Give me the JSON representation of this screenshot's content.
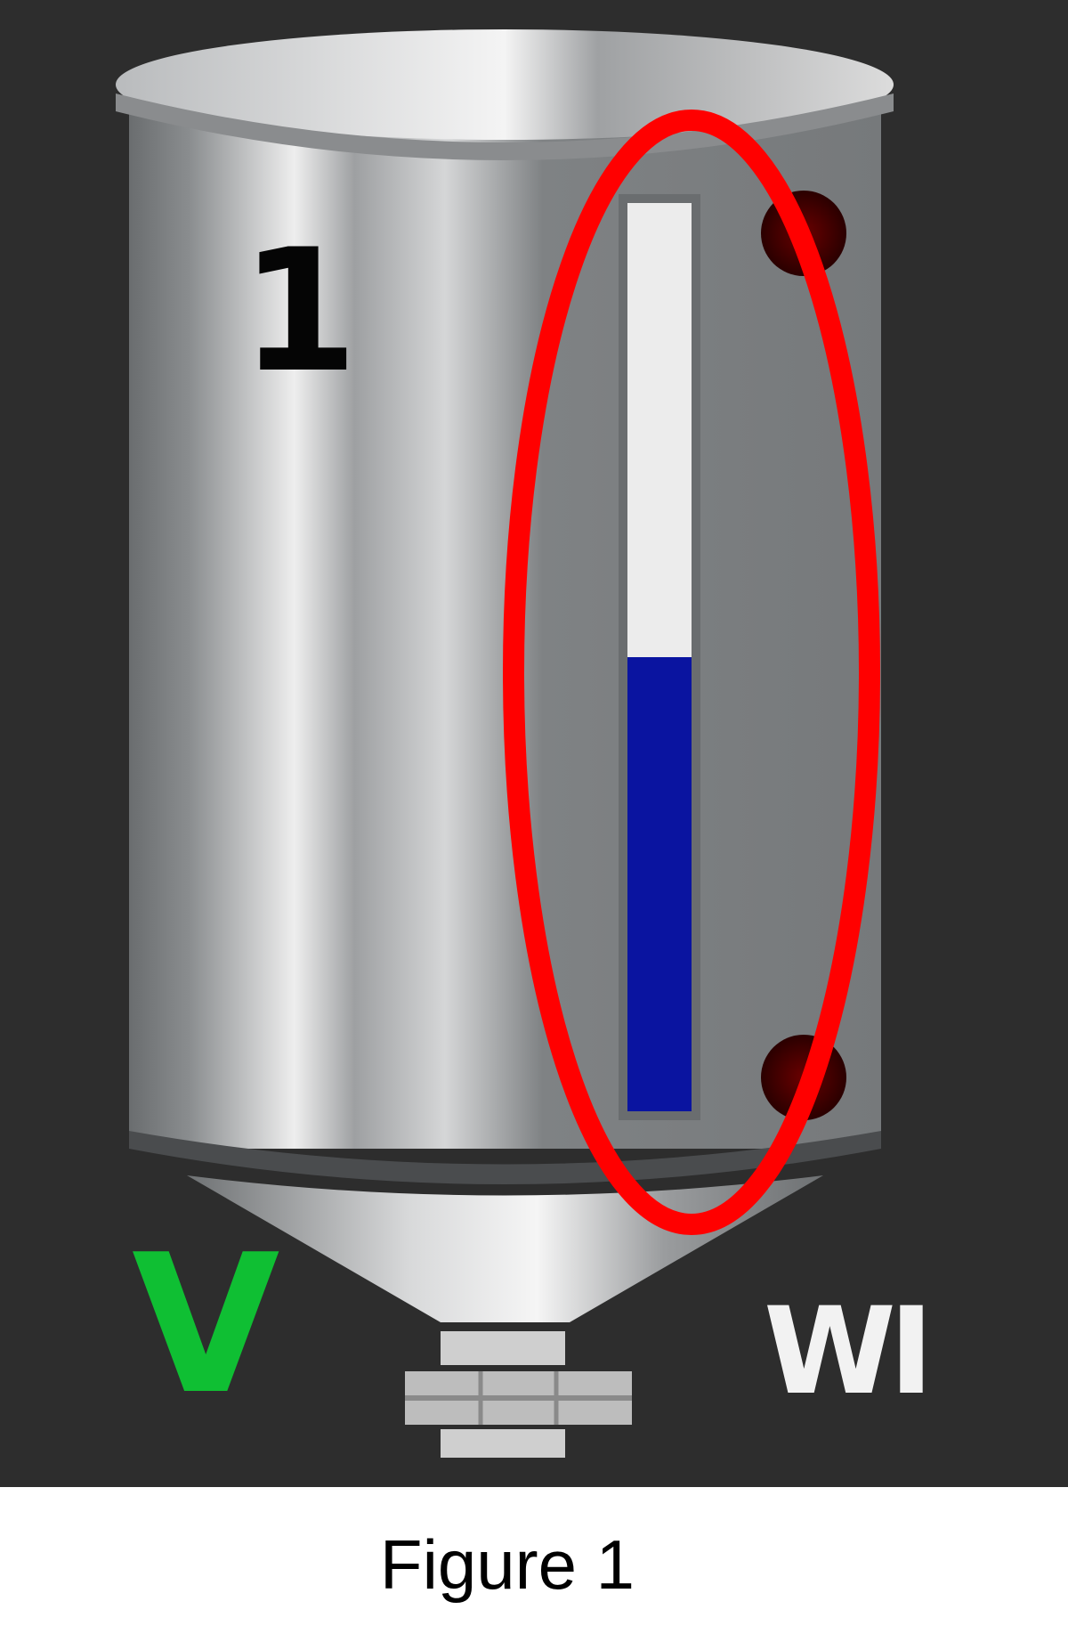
{
  "tank": {
    "number": "1",
    "level_fraction": 0.5,
    "level_color": "#0a14a0",
    "high_sensor_color": "#4a0000",
    "low_sensor_color": "#4a0000"
  },
  "status": {
    "left_label": "V",
    "left_color": "#0fbf33",
    "right_label": "WI"
  },
  "highlight": {
    "color": "#ff0000"
  },
  "caption": "Figure 1"
}
